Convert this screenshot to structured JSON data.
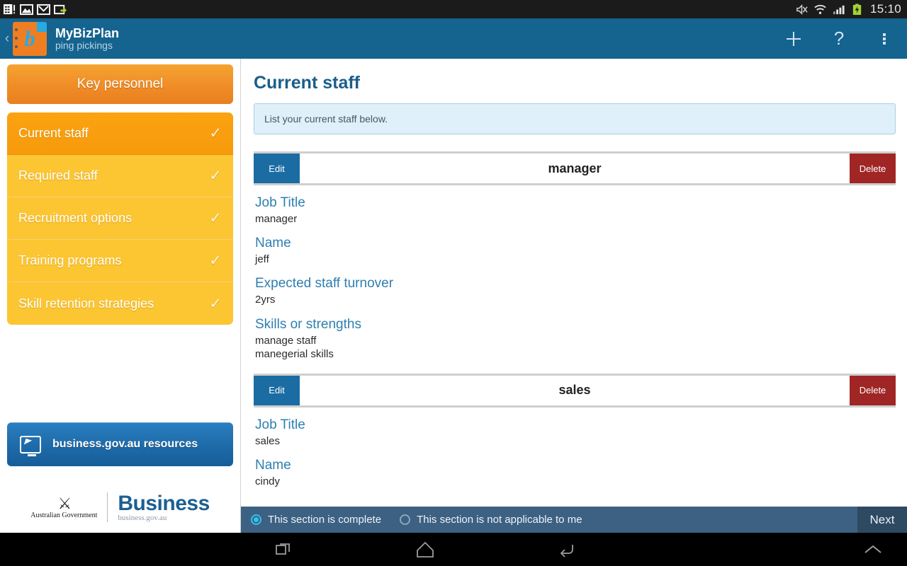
{
  "statusbar": {
    "icons": [
      "sim-card-icon",
      "gallery-image-icon",
      "gmail-icon",
      "screenshot-share-icon"
    ],
    "right_icons": [
      "mute-icon",
      "wifi-icon",
      "cell-signal-icon",
      "battery-charging-icon"
    ],
    "clock": "15:10"
  },
  "appbar": {
    "back_label": "‹",
    "app_icon_letter": "b",
    "title": "MyBizPlan",
    "subtitle": "ping pickings",
    "actions": {
      "add": "add-icon",
      "help": "?",
      "overflow": "overflow-menu-icon"
    }
  },
  "sidebar": {
    "section_header": "Key personnel",
    "items": [
      {
        "label": "Current staff",
        "tick": "✓",
        "active": true
      },
      {
        "label": "Required staff",
        "tick": "✓",
        "active": false
      },
      {
        "label": "Recruitment options",
        "tick": "✓",
        "active": false
      },
      {
        "label": "Training programs",
        "tick": "✓",
        "active": false
      },
      {
        "label": "Skill retention strategies",
        "tick": "✓",
        "active": false
      }
    ],
    "resources_button": "business.gov.au resources",
    "logo": {
      "gov_text": "Australian Government",
      "business_text": "Business",
      "business_url": "business.gov.au"
    }
  },
  "main": {
    "title": "Current staff",
    "info": "List your current staff below.",
    "edit_label": "Edit",
    "delete_label": "Delete",
    "entries": [
      {
        "name": "manager",
        "fields": [
          {
            "label": "Job Title",
            "value": "manager"
          },
          {
            "label": "Name",
            "value": "jeff"
          },
          {
            "label": "Expected staff turnover",
            "value": "2yrs"
          },
          {
            "label": "Skills or strengths",
            "value": "manage staff\nmanegerial skills"
          }
        ]
      },
      {
        "name": "sales",
        "fields": [
          {
            "label": "Job Title",
            "value": "sales"
          },
          {
            "label": "Name",
            "value": "cindy"
          }
        ]
      }
    ]
  },
  "bottombar": {
    "option_complete": "This section is complete",
    "option_na": "This section is not applicable to me",
    "selected": "complete",
    "next_label": "Next"
  },
  "navbar": {
    "recents": "recents-icon",
    "home": "home-icon",
    "back": "back-icon",
    "up": "chevron-up-icon"
  },
  "colors": {
    "appbar": "#15638f",
    "accent_orange": "#f08c27",
    "nav_yellow": "#fcc532",
    "nav_active": "#fba311",
    "title_blue": "#1b5e8a",
    "label_blue": "#2e7fb0",
    "edit_blue": "#1b6ca3",
    "delete_red": "#a02525",
    "info_bg": "#dff0fa",
    "bottombar": "#3d6182",
    "radio_on": "#2ec4ef"
  }
}
